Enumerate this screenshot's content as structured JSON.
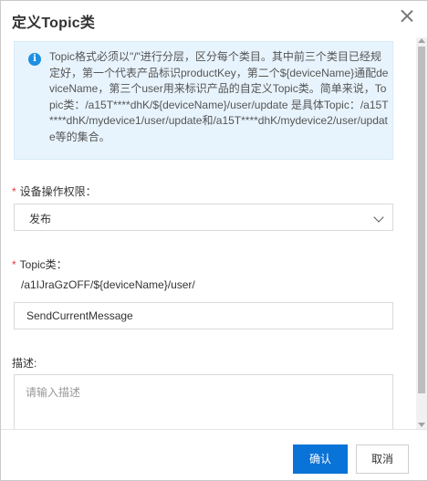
{
  "dialog": {
    "title": "定义Topic类"
  },
  "info": {
    "icon": "info-icon",
    "icon_glyph": "i",
    "text": "Topic格式必须以\"/\"进行分层，区分每个类目。其中前三个类目已经规定好，第一个代表产品标识productKey，第二个${deviceName}通配deviceName，第三个user用来标识产品的自定义Topic类。简单来说，Topic类：/a15T****dhK/${deviceName}/user/update 是具体Topic：/a15T****dhK/mydevice1/user/update和/a15T****dhK/mydevice2/user/update等的集合。"
  },
  "permission": {
    "required_mark": "*",
    "label": "设备操作权限：",
    "selected": "发布"
  },
  "topic": {
    "required_mark": "*",
    "label": "Topic类：",
    "prefix": "/a1IJraGzOFF/${deviceName}/user/",
    "value": "SendCurrentMessage"
  },
  "description": {
    "label": "描述:",
    "placeholder": "请输入描述",
    "value": ""
  },
  "footer": {
    "ok_label": "确认",
    "cancel_label": "取消"
  },
  "colors": {
    "primary": "#0a73d7",
    "info_bg": "#e8f4fd",
    "info_icon": "#1e8fe1",
    "required": "#e4393c"
  }
}
